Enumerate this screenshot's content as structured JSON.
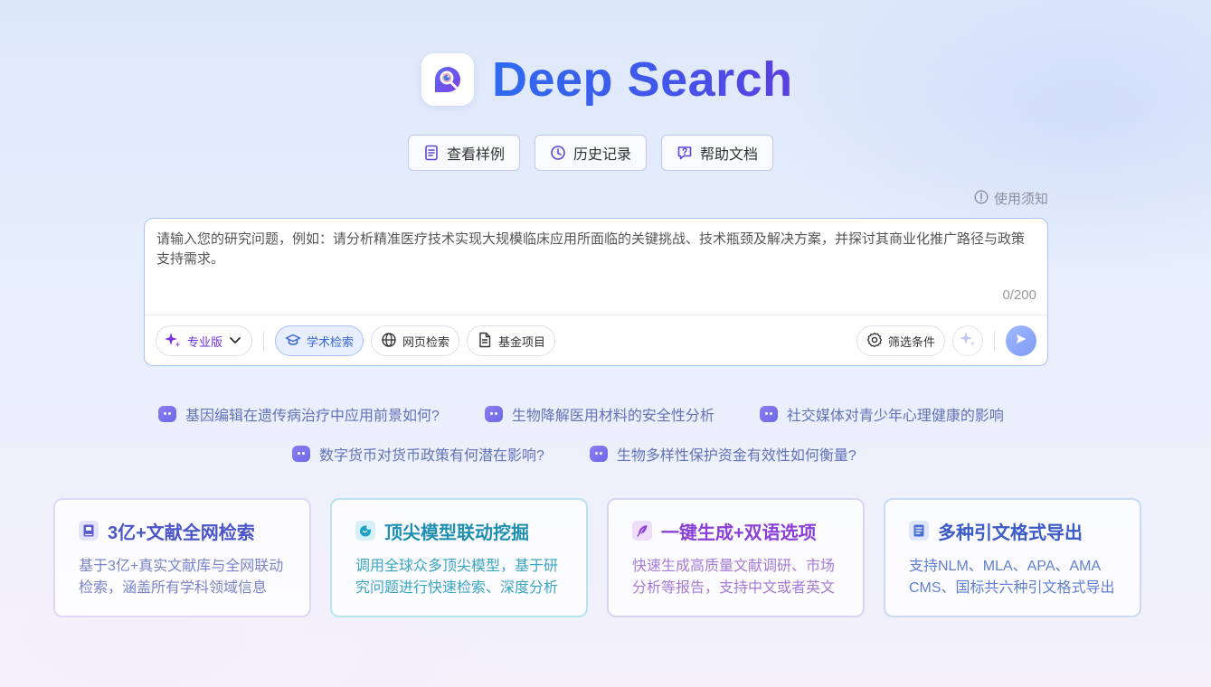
{
  "app": {
    "title": "Deep Search"
  },
  "top_buttons": [
    {
      "label": "查看样例",
      "icon": "document-icon"
    },
    {
      "label": "历史记录",
      "icon": "clock-icon"
    },
    {
      "label": "帮助文档",
      "icon": "help-chat-icon"
    }
  ],
  "notice": {
    "label": "使用须知",
    "icon": "info-icon"
  },
  "search": {
    "placeholder": "请输入您的研究问题，例如：请分析精准医疗技术实现大规模临床应用所面临的关键挑战、技术瓶颈及解决方案，并探讨其商业化推广路径与政策支持需求。",
    "value": "",
    "counter": "0/200"
  },
  "toolbar": {
    "version": {
      "label": "专业版",
      "icon": "sparkle-icon"
    },
    "modes": [
      {
        "label": "学术检索",
        "icon": "graduation-cap-icon",
        "active": true
      },
      {
        "label": "网页检索",
        "icon": "globe-icon",
        "active": false
      },
      {
        "label": "基金项目",
        "icon": "file-icon",
        "active": false
      }
    ],
    "filter": {
      "label": "筛选条件",
      "icon": "gear-icon"
    },
    "enhance_icon": "sparkle-icon",
    "send_icon": "send-icon"
  },
  "suggestions": {
    "row1": [
      "基因编辑在遗传病治疗中应用前景如何?",
      "生物降解医用材料的安全性分析",
      "社交媒体对青少年心理健康的影响"
    ],
    "row2": [
      "数字货币对货币政策有何潜在影响?",
      "生物多样性保护资金有效性如何衡量?"
    ]
  },
  "features": [
    {
      "title": "3亿+文献全网检索",
      "desc": "基于3亿+真实文献库与全网联动检索，涵盖所有学科领域信息",
      "icon": "book-icon",
      "title_color": "#4a55c9",
      "desc_color": "#7a84c9"
    },
    {
      "title": "顶尖模型联动挖掘",
      "desc": "调用全球众多顶尖模型，基于研究问题进行快速检索、深度分析",
      "icon": "brain-icon",
      "title_color": "#1f8fb0",
      "desc_color": "#3aa5c2"
    },
    {
      "title": "一键生成+双语选项",
      "desc": "快速生成高质量文献调研、市场分析等报告，支持中文或者英文",
      "icon": "feather-icon",
      "title_color": "#8a3fd6",
      "desc_color": "#a57bd6"
    },
    {
      "title": "多种引文格式导出",
      "desc": "支持NLM、MLA、APA、AMA CMS、国标共六种引文格式导出",
      "icon": "list-doc-icon",
      "title_color": "#3a5bc8",
      "desc_color": "#5f7fd0"
    }
  ]
}
